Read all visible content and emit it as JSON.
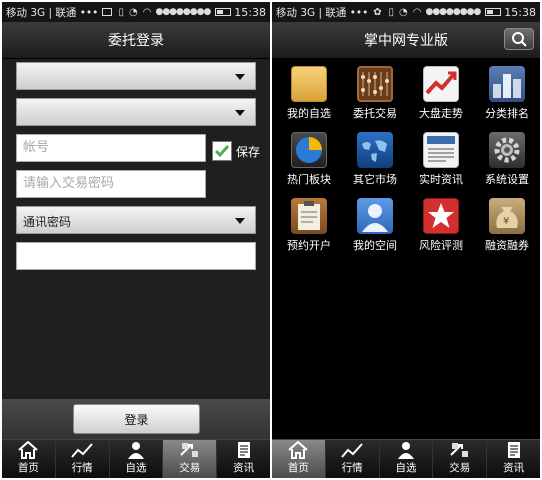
{
  "status": {
    "carrier": "移动 3G | 联通 •••",
    "time": "15:38"
  },
  "left": {
    "title": "委托登录",
    "account_placeholder": "帐号",
    "password_placeholder": "请输入交易密码",
    "save_label": "保存",
    "comm_password_label": "通讯密码",
    "login_label": "登录"
  },
  "right": {
    "title": "掌中网专业版",
    "apps": [
      {
        "label": "我的自选",
        "icon": "folder-icon"
      },
      {
        "label": "委托交易",
        "icon": "abacus-icon"
      },
      {
        "label": "大盘走势",
        "icon": "trend-chart-icon"
      },
      {
        "label": "分类排名",
        "icon": "ranking-icon"
      },
      {
        "label": "热门板块",
        "icon": "pie-chart-icon"
      },
      {
        "label": "其它市场",
        "icon": "world-map-icon"
      },
      {
        "label": "实时资讯",
        "icon": "newspaper-icon"
      },
      {
        "label": "系统设置",
        "icon": "gear-icon"
      },
      {
        "label": "预约开户",
        "icon": "clipboard-icon"
      },
      {
        "label": "我的空间",
        "icon": "user-icon"
      },
      {
        "label": "风险评测",
        "icon": "star-icon"
      },
      {
        "label": "融资融券",
        "icon": "money-bag-icon"
      }
    ]
  },
  "tabs": [
    {
      "label": "首页",
      "icon": "home-icon"
    },
    {
      "label": "行情",
      "icon": "chart-line-icon"
    },
    {
      "label": "自选",
      "icon": "person-icon"
    },
    {
      "label": "交易",
      "icon": "exchange-icon"
    },
    {
      "label": "资讯",
      "icon": "document-icon"
    }
  ],
  "colors": {
    "checkmark": "#4caf50",
    "star_bg": "#d32f2f",
    "user_bg": "#3f7fd6"
  }
}
